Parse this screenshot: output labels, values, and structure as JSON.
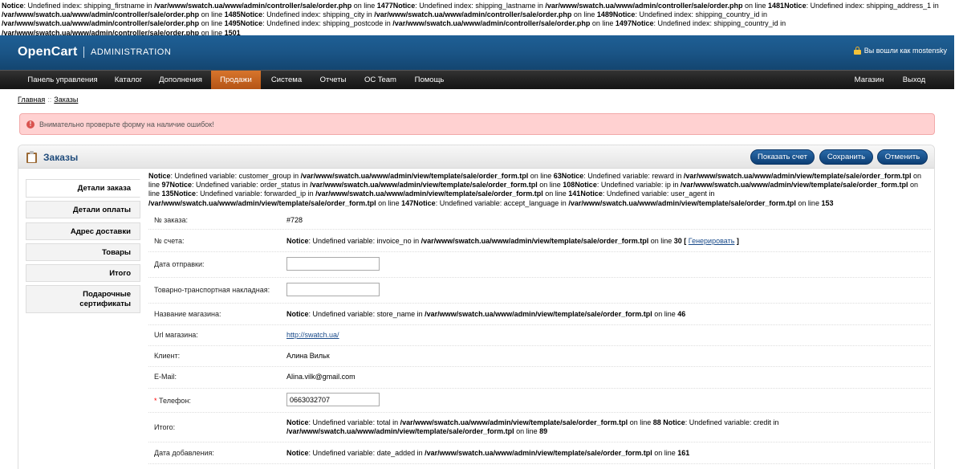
{
  "top_notice": {
    "text": "Notice: Undefined index: shipping_firstname in /var/www/swatch.ua/www/admin/controller/sale/order.php on line 1477Notice: Undefined index: shipping_lastname in /var/www/swatch.ua/www/admin/controller/sale/order.php on line 1481Notice: Undefined index: shipping_address_1 in /var/www/swatch.ua/www/admin/controller/sale/order.php on line 1485Notice: Undefined index: shipping_city in /var/www/swatch.ua/www/admin/controller/sale/order.php on line 1489Notice: Undefined index: shipping_country_id in /var/www/swatch.ua/www/admin/controller/sale/order.php on line 1495Notice: Undefined index: shipping_postcode in /var/www/swatch.ua/www/admin/controller/sale/order.php on line 1497Notice: Undefined index: shipping_country_id in /var/www/swatch.ua/www/admin/controller/sale/order.php on line 1501"
  },
  "header": {
    "logo": "OpenCart",
    "subtitle": "ADMINISTRATION",
    "login_text": "Вы вошли как mostensky"
  },
  "menu": {
    "items": [
      "Панель управления",
      "Каталог",
      "Дополнения",
      "Продажи",
      "Система",
      "Отчеты",
      "OC Team",
      "Помощь"
    ],
    "right_items": [
      "Магазин",
      "Выход"
    ],
    "active": "Продажи"
  },
  "breadcrumb": {
    "home": "Главная",
    "separator": "::",
    "current": "Заказы"
  },
  "warning": {
    "text": "Внимательно проверьте форму на наличие ошибок!"
  },
  "box": {
    "title": "Заказы",
    "buttons": {
      "invoice": "Показать счет",
      "save": "Сохранить",
      "cancel": "Отменить"
    }
  },
  "tabs": [
    "Детали заказа",
    "Детали оплаты",
    "Адрес доставки",
    "Товары",
    "Итого",
    "Подарочные сертификаты"
  ],
  "content_notice": {
    "text": "Notice: Undefined variable: customer_group in /var/www/swatch.ua/www/admin/view/template/sale/order_form.tpl on line 63Notice: Undefined variable: reward in /var/www/swatch.ua/www/admin/view/template/sale/order_form.tpl on line 97Notice: Undefined variable: order_status in /var/www/swatch.ua/www/admin/view/template/sale/order_form.tpl on line 108Notice: Undefined variable: ip in /var/www/swatch.ua/www/admin/view/template/sale/order_form.tpl on line 135Notice: Undefined variable: forwarded_ip in /var/www/swatch.ua/www/admin/view/template/sale/order_form.tpl on line 141Notice: Undefined variable: user_agent in /var/www/swatch.ua/www/admin/view/template/sale/order_form.tpl on line 147Notice: Undefined variable: accept_language in /var/www/swatch.ua/www/admin/view/template/sale/order_form.tpl on line 153"
  },
  "form": {
    "order_no": {
      "label": "№ заказа:",
      "value": "#728"
    },
    "invoice_no": {
      "label": "№ счета:",
      "notice": "Notice: Undefined variable: invoice_no in /var/www/swatch.ua/www/admin/view/template/sale/order_form.tpl on line 30",
      "generate_open": "[",
      "generate": "Генерировать",
      "generate_close": "]"
    },
    "ship_date": {
      "label": "Дата отправки:",
      "value": ""
    },
    "waybill": {
      "label": "Товарно-транспортная накладная:",
      "value": ""
    },
    "store_name": {
      "label": "Название магазина:",
      "notice": "Notice: Undefined variable: store_name in /var/www/swatch.ua/www/admin/view/template/sale/order_form.tpl on line 46"
    },
    "store_url": {
      "label": "Url магазина:",
      "value": "http://swatch.ua/"
    },
    "customer": {
      "label": "Клиент:",
      "value": "Алина Вильк"
    },
    "email": {
      "label": "E-Mail:",
      "value": "Alina.vilk@gmail.com"
    },
    "phone": {
      "required_mark": "*",
      "label": "Телефон:",
      "value": "0663032707"
    },
    "total": {
      "label": "Итого:",
      "notice": "Notice: Undefined variable: total in /var/www/swatch.ua/www/admin/view/template/sale/order_form.tpl on line 88 Notice: Undefined variable: credit in /var/www/swatch.ua/www/admin/view/template/sale/order_form.tpl on line 89"
    },
    "date_added": {
      "label": "Дата добавления:",
      "notice": "Notice: Undefined variable: date_added in /var/www/swatch.ua/www/admin/view/template/sale/order_form.tpl on line 161"
    }
  }
}
